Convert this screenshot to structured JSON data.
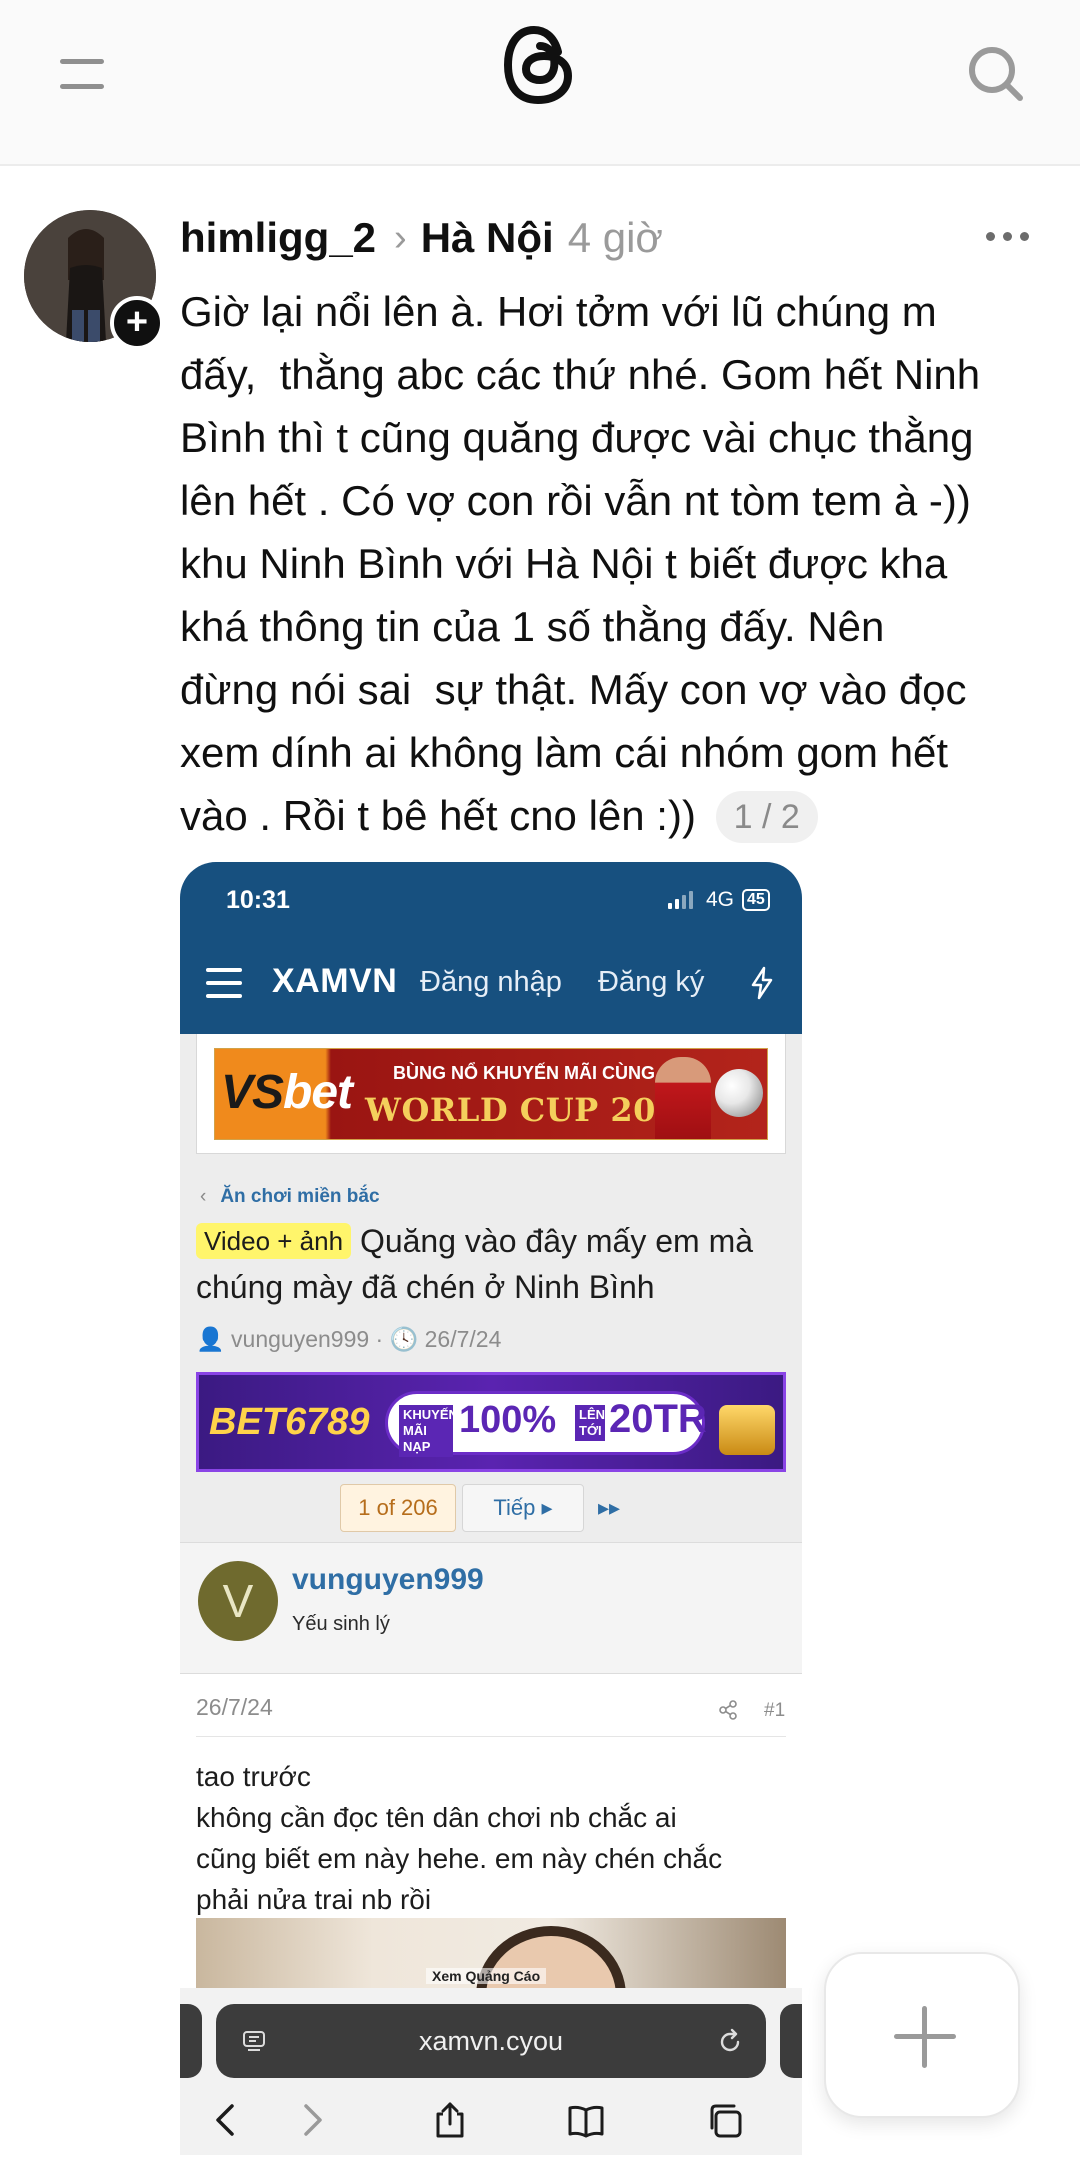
{
  "app": {
    "name": "Threads"
  },
  "post": {
    "username": "himligg_2",
    "location": "Hà Nội",
    "time": "4 giờ",
    "text": "Giờ lại nổi lên à. Hơi tởm với lũ chúng m\nđấy,  thằng abc các thứ nhé. Gom hết Ninh\nBình thì t cũng quăng được vài chục thằng\nlên hết . Có vợ con rồi vẫn nt tòm tem à -))\nkhu Ninh Bình với Hà Nội t biết được kha\nkhá thông tin của 1 số thằng đấy. Nên\nđừng nói sai  sự thật. Mấy con vợ vào đọc\nxem dính ai không làm cái nhóm gom hết\nvào . Rồi t bê hết cno lên :))",
    "media_counter": "1 / 2"
  },
  "screenshot": {
    "status_time": "10:31",
    "network": "4G",
    "battery": "45",
    "site_brand": "XAMVN",
    "login_label": "Đăng nhập",
    "register_label": "Đăng ký",
    "ad1": {
      "brand_a": "VS",
      "brand_b": "bet",
      "line1": "BÙNG NỔ KHUYẾN MÃI CÙNG",
      "line2": "WORLD CUP 2026"
    },
    "breadcrumb": "Ăn chơi miền bắc",
    "thread_tag": "Video + ảnh",
    "thread_title": "Quăng vào đây mấy em mà chúng mày đã chén ở Ninh Bình",
    "thread_author": "vunguyen999",
    "thread_date": "26/7/24",
    "ad2": {
      "brand": "BET6789",
      "left_small": "KHUYẾN MÃI NẠP",
      "percent": "100%",
      "right_small": "LÊN TỚI",
      "amount": "20TR"
    },
    "pager": {
      "current": "1 of 206",
      "next": "Tiếp"
    },
    "author": {
      "initial": "V",
      "name": "vunguyen999",
      "title": "Yếu sinh lý"
    },
    "message": {
      "date": "26/7/24",
      "number": "#1",
      "body": "tao trước\nkhông cần đọc tên dân chơi nb chắc ai\ncũng biết em này hehe. em này chén chắc\nphải nửa trai nb rồi"
    },
    "ad_label": "Xem Quảng Cáo",
    "url": "xamvn.cyou"
  }
}
